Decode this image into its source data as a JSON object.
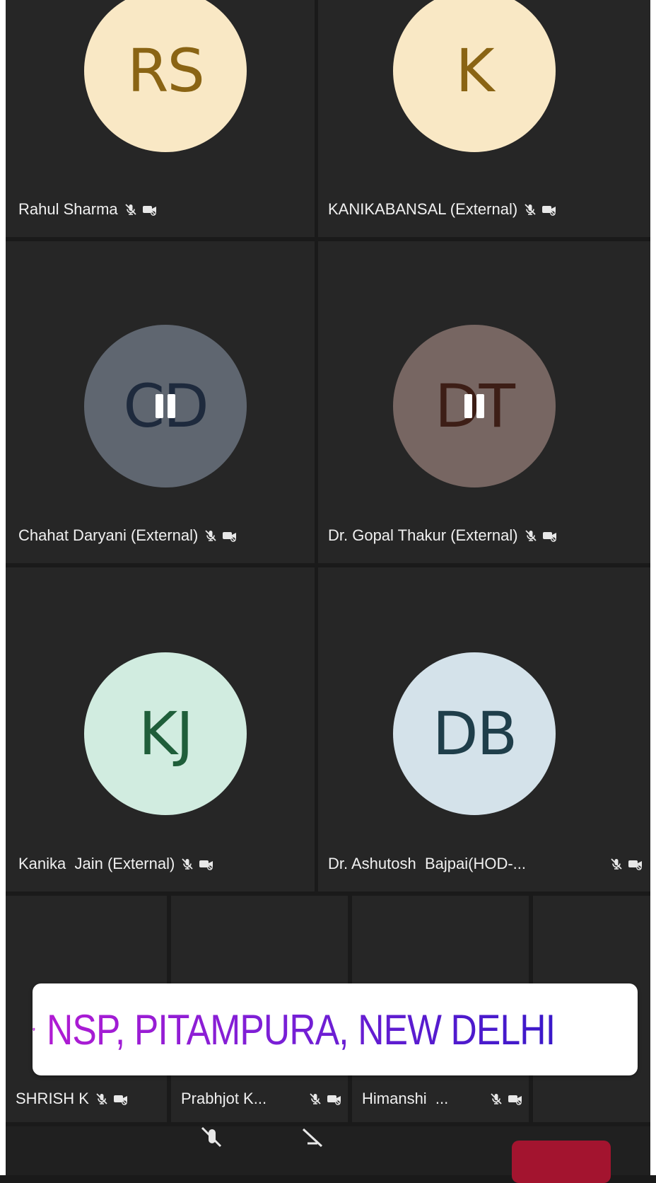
{
  "tiles": [
    {
      "name": "Rahul Sharma",
      "initials": "RS",
      "avatar_bg": "#f9e8c5",
      "initials_color": "#8a6414"
    },
    {
      "name": "KANIKABANSAL (External)",
      "initials": "K",
      "avatar_bg": "#f9e8c5",
      "initials_color": "#8a6414"
    },
    {
      "name": "Chahat Daryani (External)",
      "initials": "CD",
      "avatar_bg": "#5f6670",
      "initials_color": "#1e2a3d"
    },
    {
      "name": "Dr. Gopal Thakur (External)",
      "initials": "DT",
      "avatar_bg": "#776662",
      "initials_color": "#3d1e16"
    },
    {
      "name": "Kanika  Jain (External)",
      "initials": "KJ",
      "avatar_bg": "#d1ece0",
      "initials_color": "#1f5e3a"
    },
    {
      "name": "Dr. Ashutosh  Bajpai(HOD-...",
      "initials": "DB",
      "avatar_bg": "#d4e2ea",
      "initials_color": "#1f3e4a"
    }
  ],
  "bottom_tiles": [
    {
      "name": "SHRISH K"
    },
    {
      "name": "Prabhjot K..."
    },
    {
      "name": "Himanshi  ..."
    }
  ],
  "location": {
    "text": "NSP, PITAMPURA, NEW DELHI",
    "icon": "map-pin-icon"
  },
  "icons": {
    "muted": "mic-off-icon",
    "camera_off": "camera-off-icon"
  },
  "colors": {
    "tile_bg": "#262626",
    "leave_button": "#a3142f",
    "location_gradient_start": "#b11bd3",
    "location_gradient_end": "#3a18c9"
  }
}
